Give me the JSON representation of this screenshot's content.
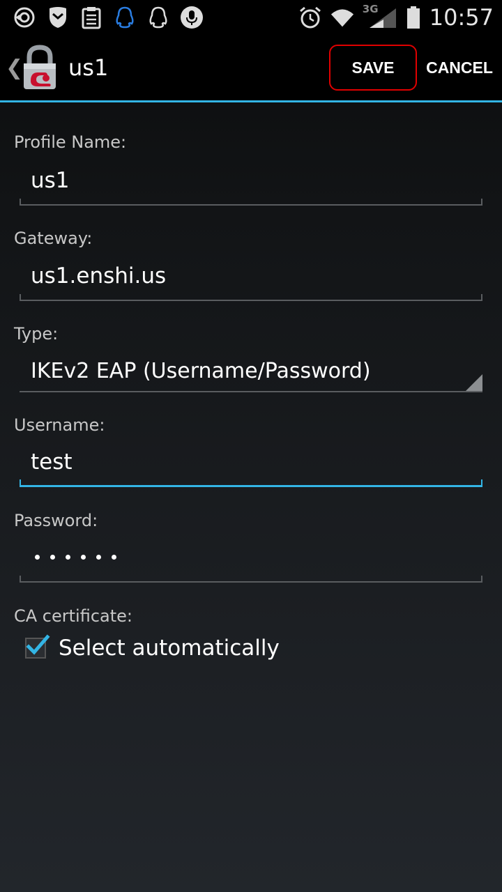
{
  "status_bar": {
    "time": "10:57",
    "network": "3G",
    "left_icons": [
      "sync-icon",
      "shield-icon",
      "clipboard-icon",
      "qq-blue-icon",
      "qq-icon",
      "microphone-icon"
    ],
    "right_icons": [
      "alarm-icon",
      "wifi-icon",
      "signal-icon",
      "battery-icon"
    ]
  },
  "action_bar": {
    "title": "us1",
    "save_label": "SAVE",
    "cancel_label": "CANCEL"
  },
  "form": {
    "profile_name": {
      "label": "Profile Name:",
      "value": "us1"
    },
    "gateway": {
      "label": "Gateway:",
      "value": "us1.enshi.us"
    },
    "type": {
      "label": "Type:",
      "value": "IKEv2 EAP (Username/Password)"
    },
    "username": {
      "label": "Username:",
      "value": "test"
    },
    "password": {
      "label": "Password:",
      "masked_length": 6
    },
    "ca_certificate": {
      "label": "CA certificate:",
      "checkbox_label": "Select automatically",
      "checked": true
    }
  },
  "colors": {
    "accent": "#33b5e5",
    "highlight_border": "#e00000",
    "app_icon_red": "#c8102e"
  }
}
